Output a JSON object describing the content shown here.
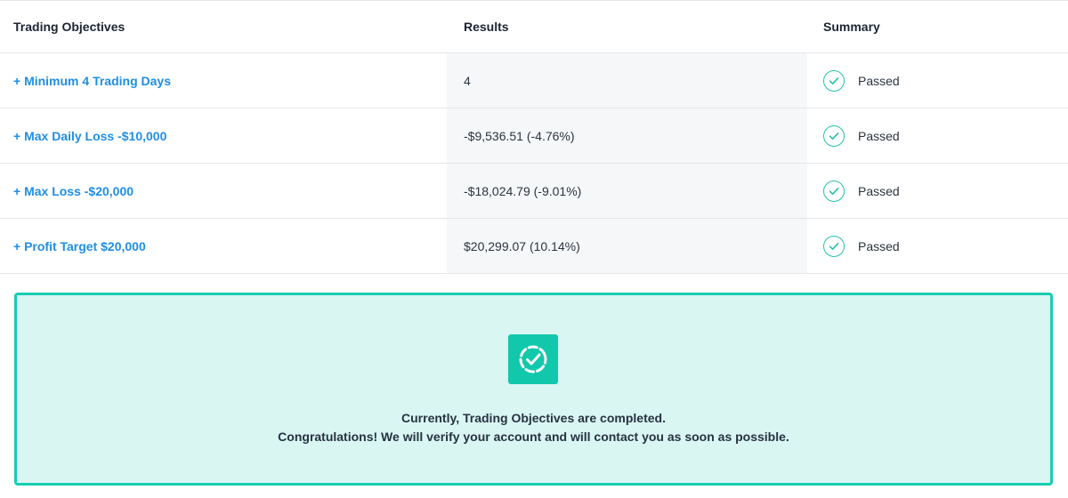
{
  "table": {
    "headers": {
      "objectives": "Trading Objectives",
      "results": "Results",
      "summary": "Summary"
    },
    "rows": [
      {
        "objective": "+ Minimum 4 Trading Days",
        "result": "4",
        "status": "Passed"
      },
      {
        "objective": "+ Max Daily Loss -$10,000",
        "result": "-$9,536.51 (-4.76%)",
        "status": "Passed"
      },
      {
        "objective": "+ Max Loss -$20,000",
        "result": "-$18,024.79 (-9.01%)",
        "status": "Passed"
      },
      {
        "objective": "+ Profit Target $20,000",
        "result": "$20,299.07 (10.14%)",
        "status": "Passed"
      }
    ]
  },
  "banner": {
    "icon": "dashed-circle-check-icon",
    "line1": "Currently, Trading Objectives are completed.",
    "line2": "Congratulations! We will verify your account and will contact you as soon as possible."
  },
  "colors": {
    "accent": "#17cdb1",
    "link": "#1f8ee6",
    "banner_bg": "#d9f6f3"
  }
}
